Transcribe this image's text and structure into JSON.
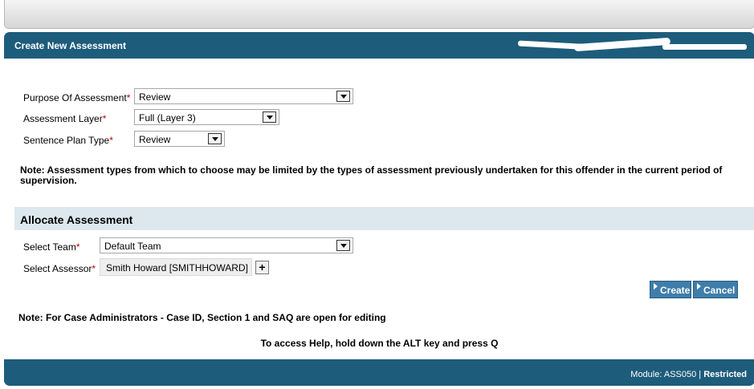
{
  "header": {
    "title": "Create New Assessment"
  },
  "form": {
    "purpose": {
      "label": "Purpose Of Assessment",
      "required_mark": "*",
      "value": "Review"
    },
    "layer": {
      "label": "Assessment Layer",
      "required_mark": "*",
      "value": "Full (Layer 3)"
    },
    "plan_type": {
      "label": "Sentence Plan Type",
      "required_mark": "*",
      "value": "Review"
    }
  },
  "note1": "Note: Assessment types from which to choose may be limited by the types of assessment previously undertaken for this offender in the current period of supervision.",
  "allocate": {
    "title": "Allocate Assessment",
    "team": {
      "label": "Select Team",
      "required_mark": "*",
      "value": "Default Team"
    },
    "assessor": {
      "label": "Select Assessor",
      "required_mark": "*",
      "value": "Smith Howard [SMITHHOWARD]",
      "add_label": "+"
    }
  },
  "buttons": {
    "create": "Create",
    "cancel": "Cancel"
  },
  "note2": "Note: For Case Administrators - Case ID, Section 1 and SAQ are open for editing",
  "help_text": "To access Help, hold down the ALT key and press Q",
  "footer": {
    "module_prefix": "Module: ASS050 | ",
    "restricted": "Restricted"
  },
  "colors": {
    "header_bg": "#1d5c7b",
    "section_bg": "#dde8ee",
    "button_bg": "#3f7eab",
    "required": "#c00000"
  },
  "icons": {
    "dropdown": "chevron-down-icon",
    "action": "triangle-right-icon"
  }
}
